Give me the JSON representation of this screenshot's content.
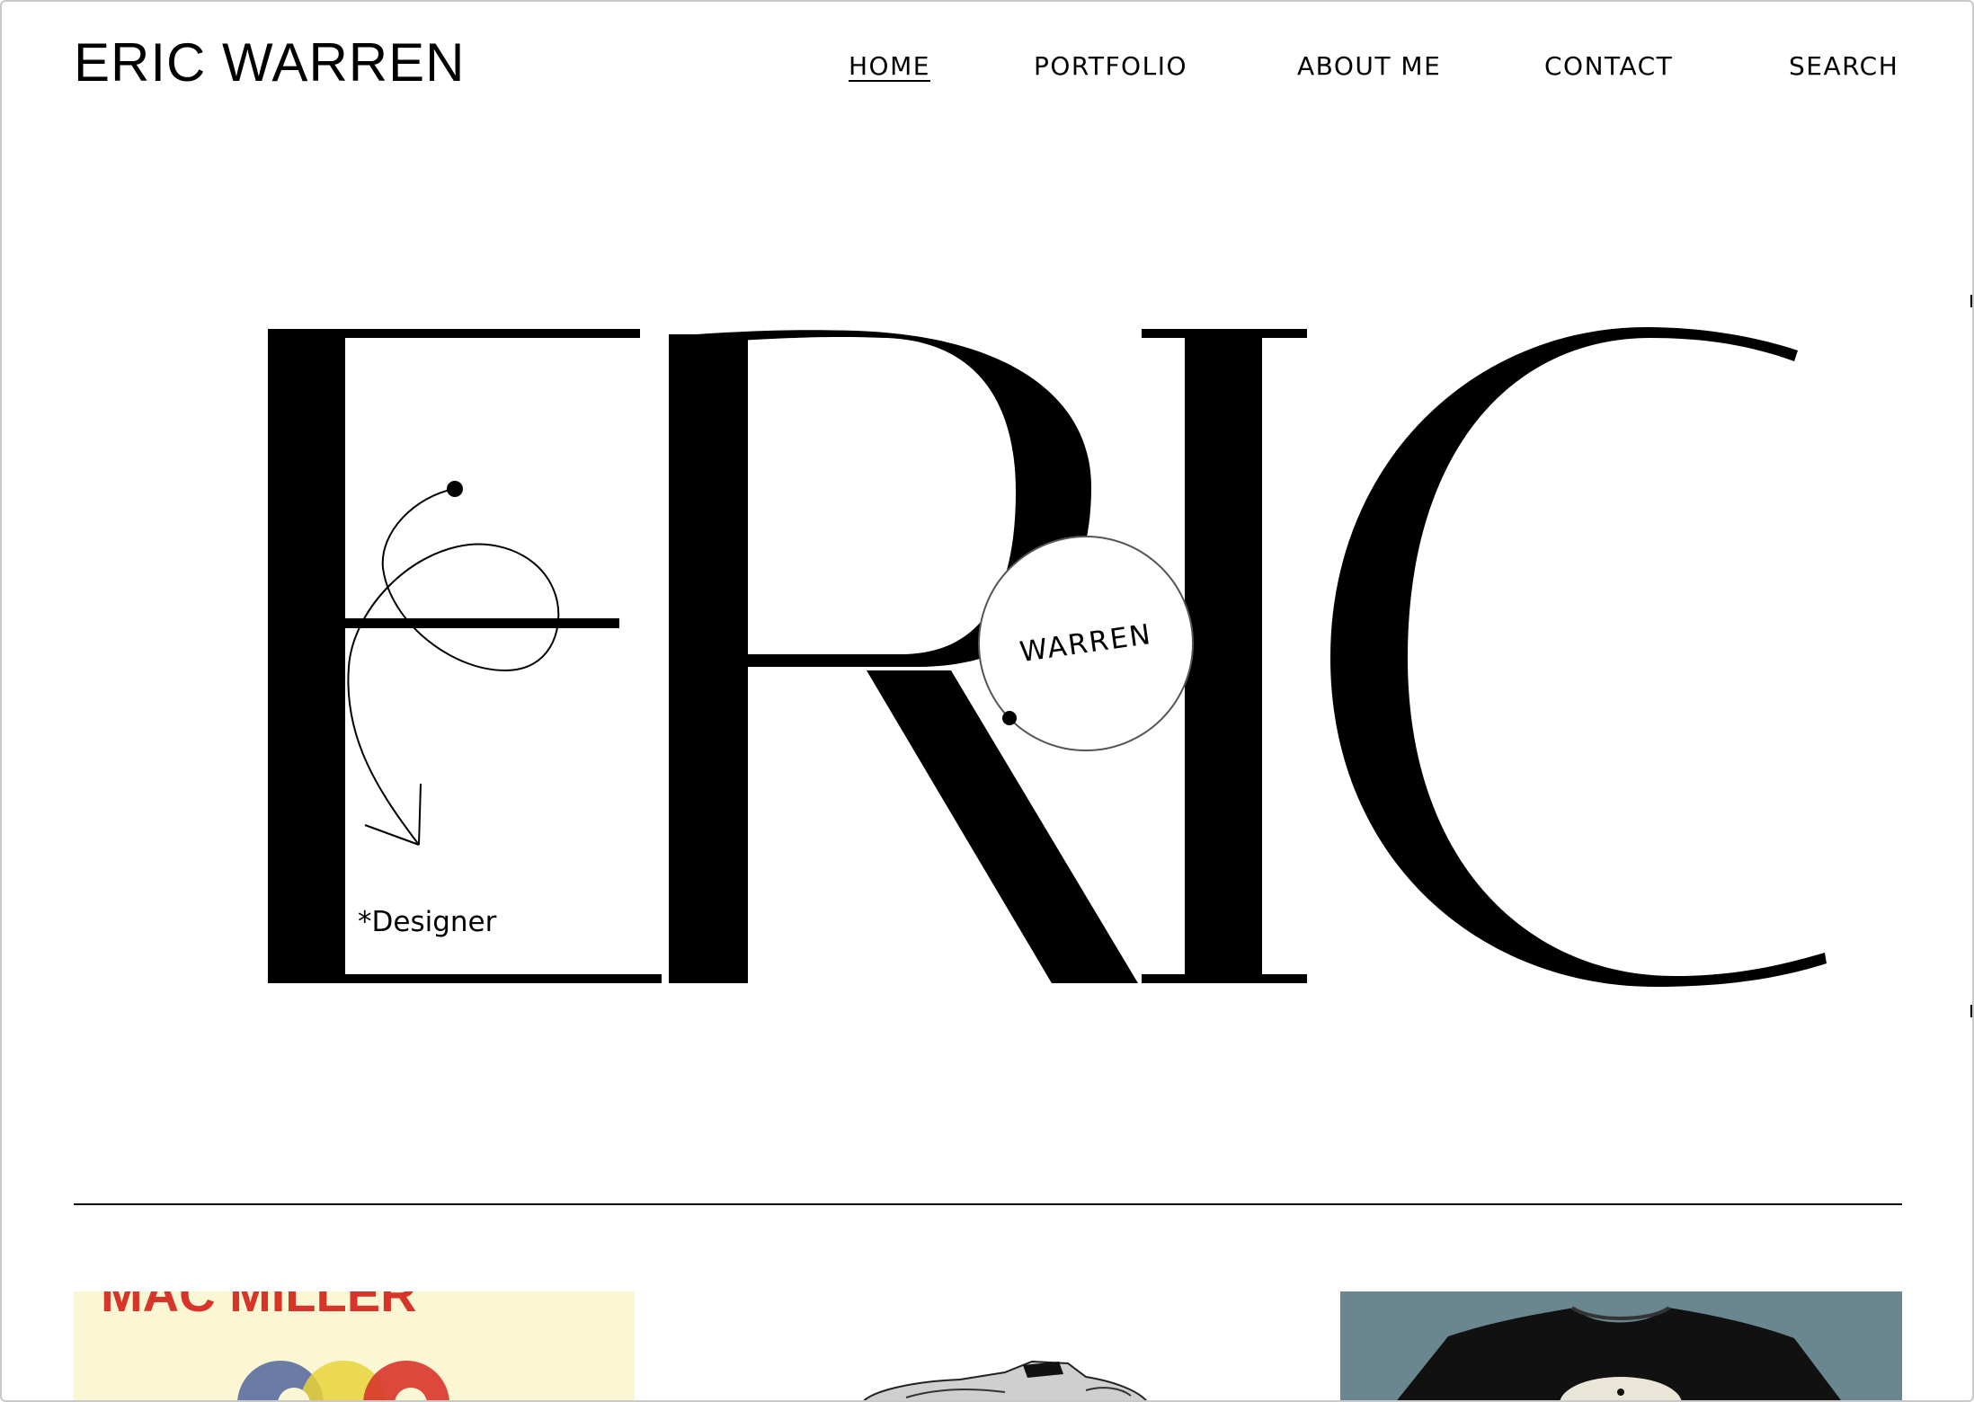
{
  "site": {
    "brand": "ERIC WARREN"
  },
  "nav": {
    "items": [
      {
        "label": "HOME",
        "active": true
      },
      {
        "label": "PORTFOLIO",
        "active": false
      },
      {
        "label": "ABOUT ME",
        "active": false
      },
      {
        "label": "CONTACT",
        "active": false
      },
      {
        "label": "SEARCH",
        "active": false
      }
    ]
  },
  "hero": {
    "word": "ERIC",
    "circle_label": "WARREN",
    "annotation": "*Designer"
  },
  "portfolio": {
    "cards": [
      {
        "title_fragment": "MAC MILLER",
        "icon": "poster-thumbnail",
        "bg": "#fbf6d3"
      },
      {
        "icon": "sneaker-sketch-thumbnail",
        "bg": "#ffffff"
      },
      {
        "icon": "tshirt-thumbnail",
        "bg": "#6a878f"
      }
    ]
  },
  "colors": {
    "background": "#ffffff",
    "text": "#000000",
    "divider": "#000000"
  }
}
